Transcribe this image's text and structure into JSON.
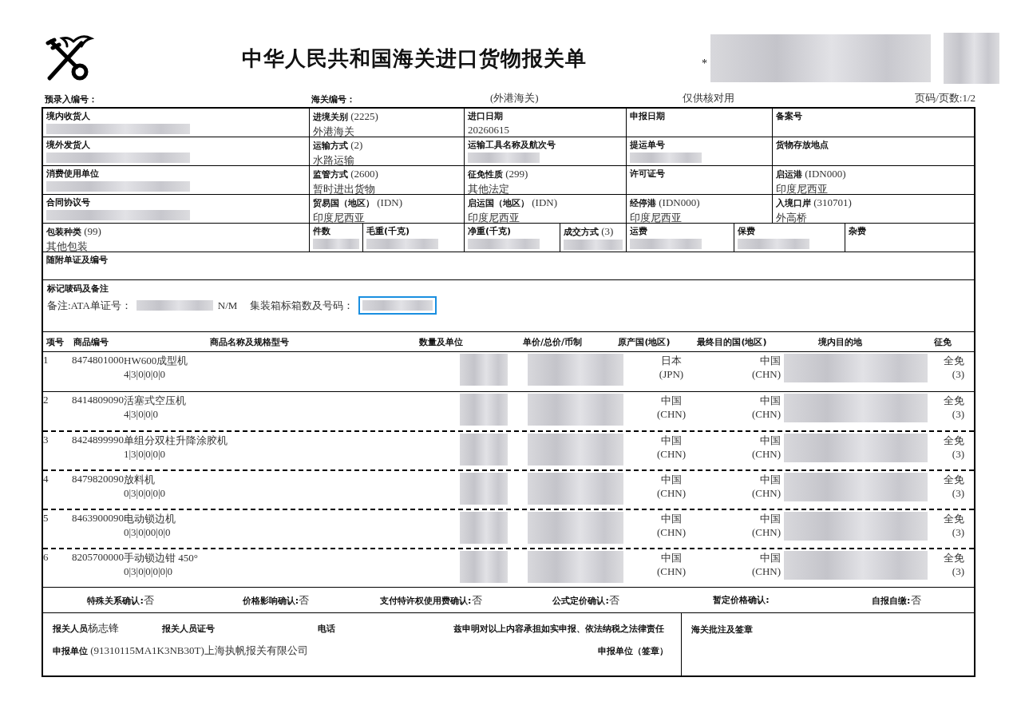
{
  "header": {
    "title": "中华人民共和国海关进口货物报关单",
    "star": "*",
    "pre_entry_label": "预录入编号：",
    "customs_no_label": "海关编号：",
    "customs_office": "(外港海关)",
    "note": "仅供核对用",
    "page": "页码/页数:1/2"
  },
  "form": {
    "rows": [
      [
        {
          "label": "境内收货人",
          "redacted": true
        },
        {
          "label": "进境关别",
          "code": "(2225)",
          "value": "外港海关"
        },
        {
          "label": "进口日期",
          "value": "20260615"
        },
        {
          "label": "申报日期"
        },
        {
          "label": "备案号"
        }
      ],
      [
        {
          "label": "境外发货人",
          "redacted": true
        },
        {
          "label": "运输方式",
          "code": "(2)",
          "value": "水路运输"
        },
        {
          "label": "运输工具名称及航次号",
          "redacted": true
        },
        {
          "label": "提运单号",
          "redacted": true
        },
        {
          "label": "货物存放地点"
        }
      ],
      [
        {
          "label": "消费使用单位",
          "redacted": true
        },
        {
          "label": "监管方式",
          "code": "(2600)",
          "value": "暂时进出货物"
        },
        {
          "label": "征免性质",
          "code": "(299)",
          "value": "其他法定"
        },
        {
          "label": "许可证号"
        },
        {
          "label": "启运港",
          "code": "(IDN000)",
          "value": "印度尼西亚"
        }
      ],
      [
        {
          "label": "合同协议号",
          "redacted": true
        },
        {
          "label": "贸易国（地区）",
          "code": "(IDN)",
          "value": "印度尼西亚"
        },
        {
          "label": "启运国（地区）",
          "code": "(IDN)",
          "value": "印度尼西亚"
        },
        {
          "label": "经停港",
          "code": "(IDN000)",
          "value": "印度尼西亚"
        },
        {
          "label": "入境口岸",
          "code": "(310701)",
          "value": "外高桥"
        }
      ]
    ],
    "package_row": [
      {
        "label": "包装种类",
        "code": "(99)",
        "value": "其他包装"
      },
      {
        "label": "件数",
        "redacted": true
      },
      {
        "label": "毛重(千克)",
        "redacted": true
      },
      {
        "label": "净重(千克)",
        "redacted": true
      },
      {
        "label": "成交方式",
        "code": "(3)",
        "redacted": true
      },
      {
        "label": "运费",
        "redacted": true
      },
      {
        "label": "保费",
        "redacted": true
      },
      {
        "label": "杂费"
      }
    ],
    "attached_documents": {
      "label": "随附单证及编号"
    }
  },
  "marks": {
    "label": "标记唛码及备注",
    "remark_label": "备注:ATA单证号：",
    "remark_tail": "N/M",
    "container_label": "集装箱标箱数及号码：",
    "container_highlighted": true
  },
  "items": {
    "columns": [
      "项号",
      "商品编号",
      "商品名称及规格型号",
      "数量及单位",
      "单价/总价/币制",
      "原产国(地区)",
      "最终目的国(地区)",
      "境内目的地",
      "征免"
    ],
    "rows": [
      {
        "no": "1",
        "code": "8474801000",
        "name": "HW600成型机",
        "spec": "4|3|0|0|0|0",
        "origin": "日本",
        "origin_code": "(JPN)",
        "dest": "中国",
        "dest_code": "(CHN)",
        "exemption": "全免",
        "exemption_code": "(3)"
      },
      {
        "no": "2",
        "code": "8414809090",
        "name": "活塞式空压机",
        "spec": "4|3|0|0|0",
        "origin": "中国",
        "origin_code": "(CHN)",
        "dest": "中国",
        "dest_code": "(CHN)",
        "exemption": "全免",
        "exemption_code": "(3)"
      },
      {
        "no": "3",
        "code": "8424899990",
        "name": "单组分双柱升降涂胶机",
        "spec": "1|3|0|0|0|0",
        "origin": "中国",
        "origin_code": "(CHN)",
        "dest": "中国",
        "dest_code": "(CHN)",
        "exemption": "全免",
        "exemption_code": "(3)"
      },
      {
        "no": "4",
        "code": "8479820090",
        "name": "放料机",
        "spec": "0|3|0|0|0|0",
        "origin": "中国",
        "origin_code": "(CHN)",
        "dest": "中国",
        "dest_code": "(CHN)",
        "exemption": "全免",
        "exemption_code": "(3)"
      },
      {
        "no": "5",
        "code": "8463900090",
        "name": "电动锁边机",
        "spec": "0|3|0|00|0|0",
        "origin": "中国",
        "origin_code": "(CHN)",
        "dest": "中国",
        "dest_code": "(CHN)",
        "exemption": "全免",
        "exemption_code": "(3)"
      },
      {
        "no": "6",
        "code": "8205700000",
        "name": "手动锁边钳 450°",
        "spec": "0|3|0|0|0|0|0",
        "origin": "中国",
        "origin_code": "(CHN)",
        "dest": "中国",
        "dest_code": "(CHN)",
        "exemption": "全免",
        "exemption_code": "(3)"
      }
    ]
  },
  "confirmations": [
    {
      "label": "特殊关系确认:",
      "value": "否"
    },
    {
      "label": "价格影响确认:",
      "value": "否"
    },
    {
      "label": "支付特许权使用费确认:",
      "value": "否"
    },
    {
      "label": "公式定价确认:",
      "value": "否"
    },
    {
      "label": "暂定价格确认:"
    },
    {
      "label": "自报自缴:",
      "value": "否"
    }
  ],
  "footer": {
    "declarant_label": "报关人员",
    "declarant": "杨志锋",
    "declarant_id_label": "报关人员证号",
    "phone_label": "电话",
    "statement": "兹申明对以上内容承担如实申报、依法纳税之法律责任",
    "unit_label": "申报单位",
    "unit": "(91310115MA1K3NB30T)上海执帆报关有限公司",
    "seal": "申报单位（签章）",
    "customs_seal": "海关批注及签章"
  }
}
